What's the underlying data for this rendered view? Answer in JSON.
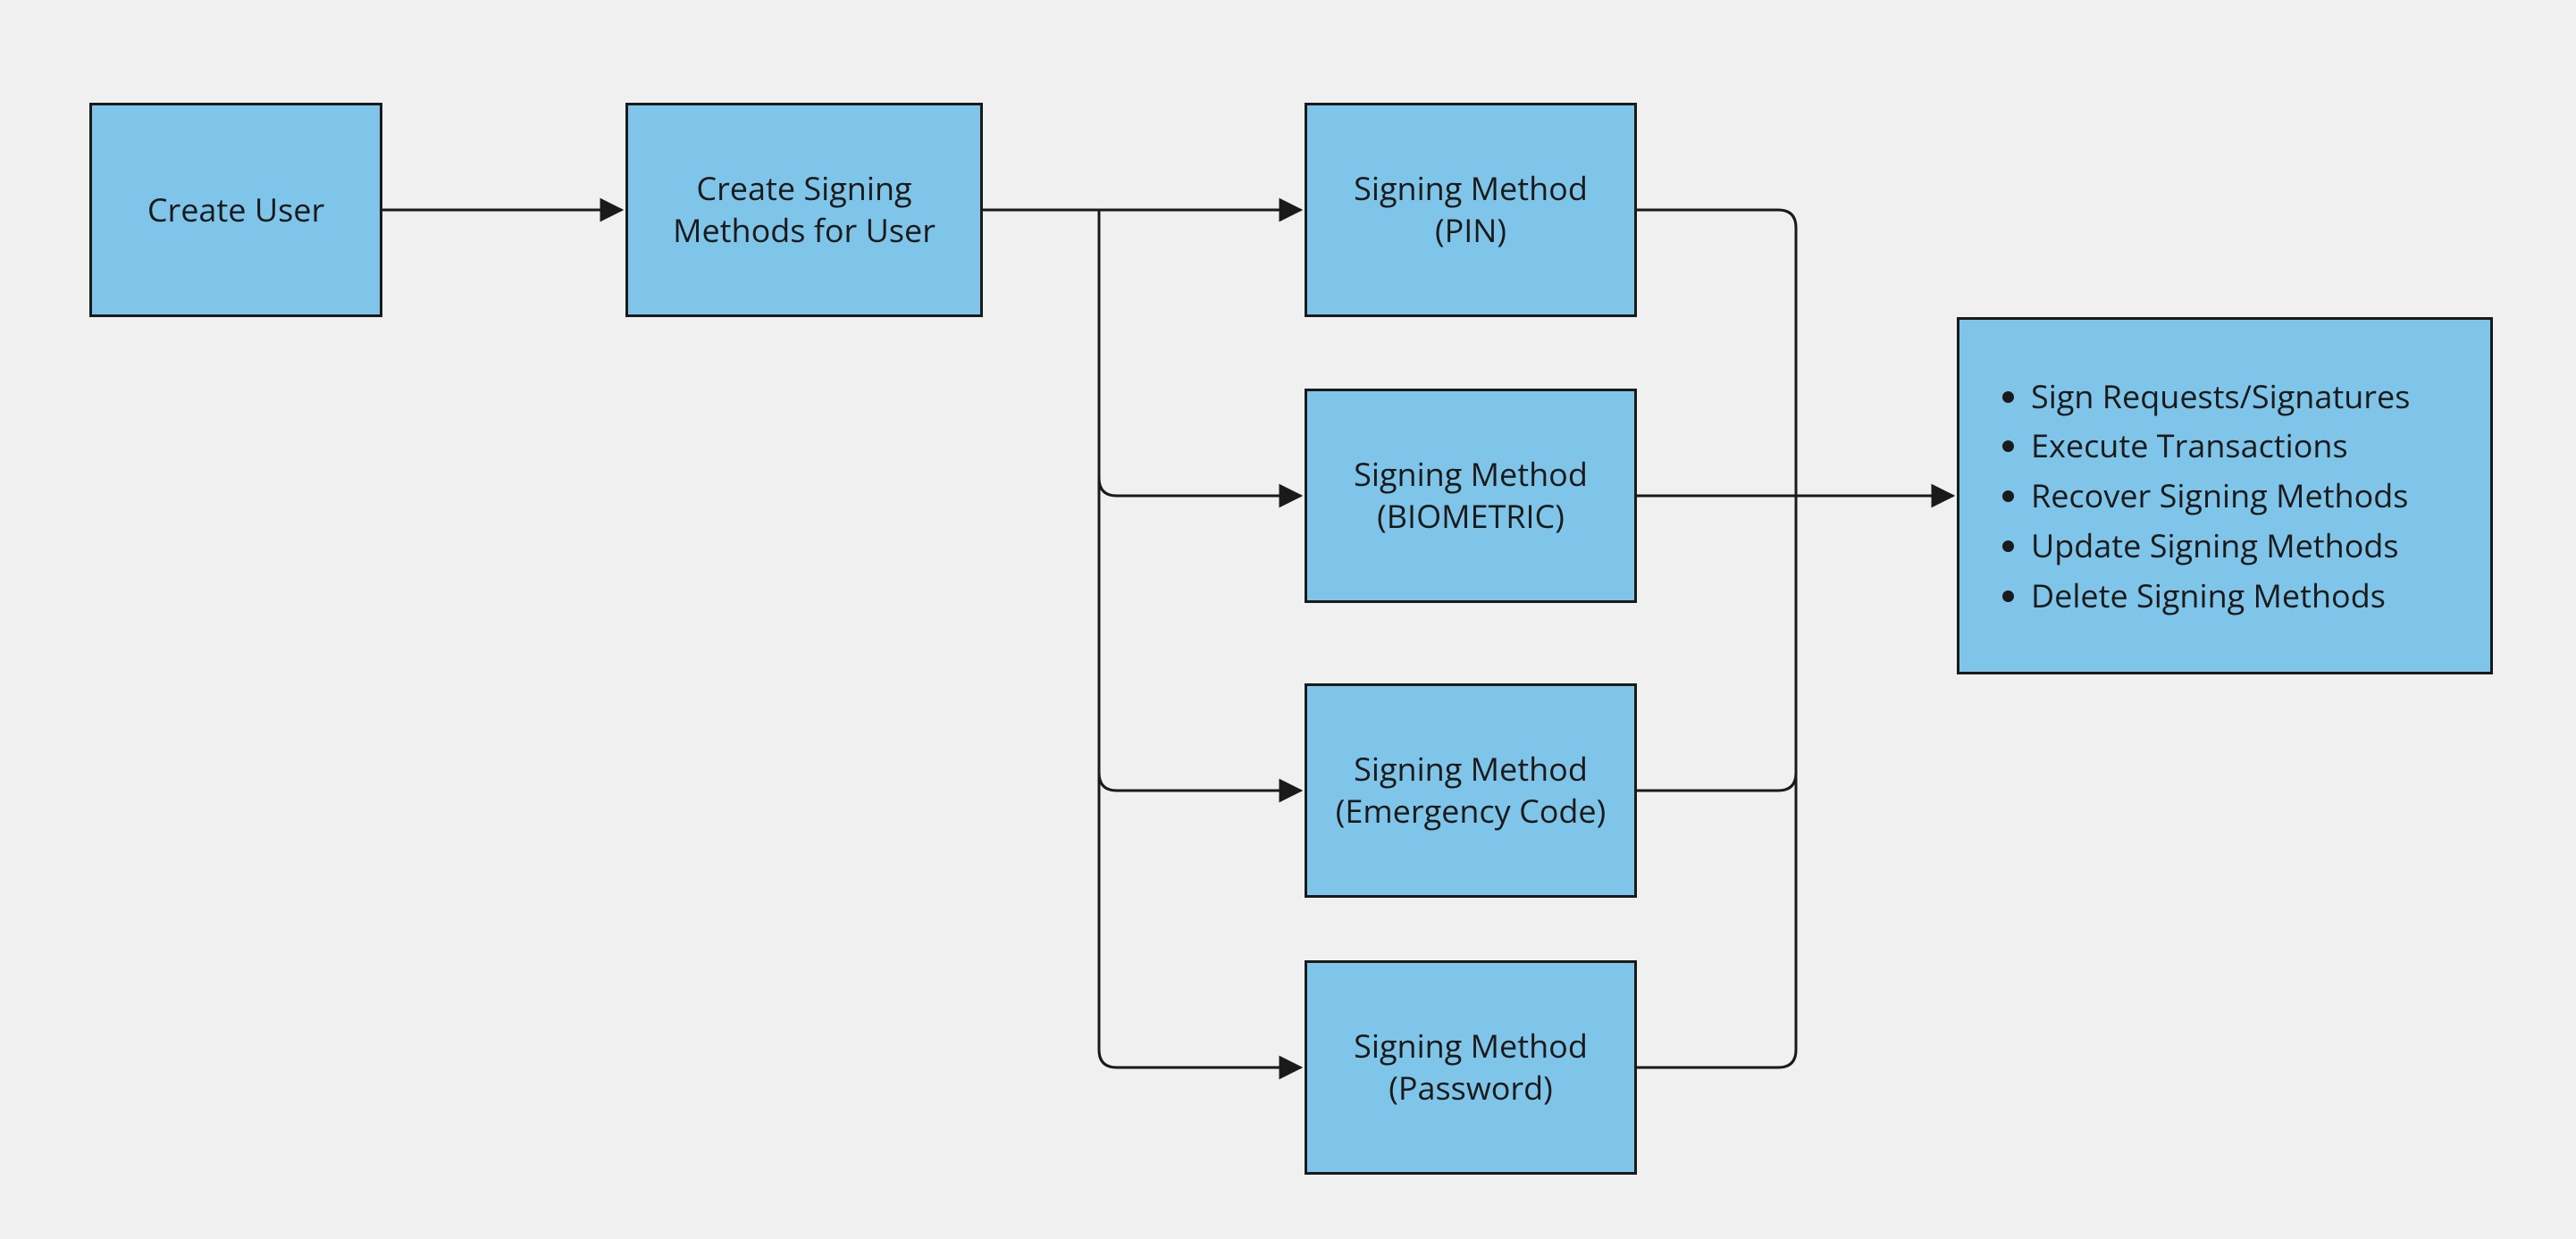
{
  "colors": {
    "node_fill": "#7fc4e9",
    "node_stroke": "#1a1a1a",
    "background": "#f0f0f0"
  },
  "nodes": {
    "create_user": "Create User",
    "create_signing_methods": "Create Signing Methods for User",
    "method_pin": "Signing Method (PIN)",
    "method_biometric": "Signing Method (BIOMETRIC)",
    "method_emergency": "Signing Method (Emergency Code)",
    "method_password": "Signing Method (Password)"
  },
  "actions": {
    "item1": "Sign Requests/Signatures",
    "item2": "Execute Transactions",
    "item3": "Recover Signing Methods",
    "item4": "Update Signing Methods",
    "item5": "Delete Signing Methods"
  }
}
